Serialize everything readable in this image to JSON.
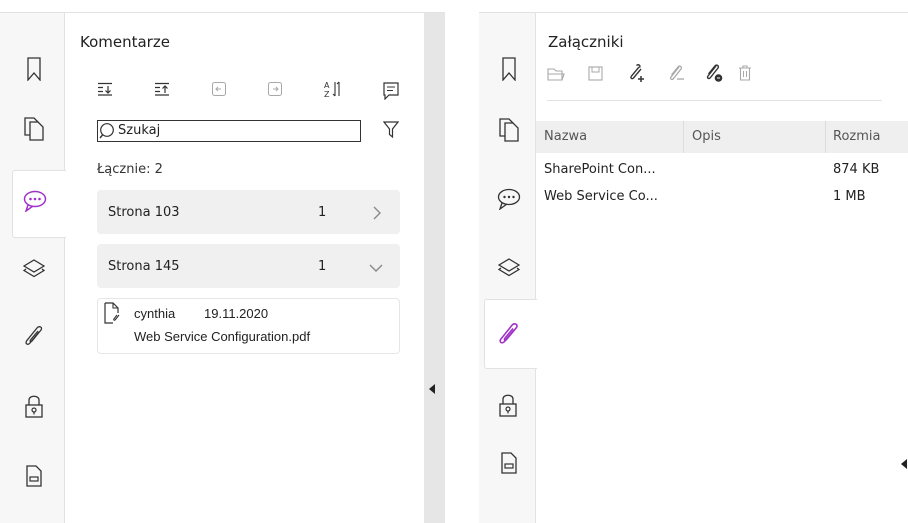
{
  "left": {
    "panel_title": "Komentarze",
    "search_placeholder": "Szukaj",
    "total_label": "Łącznie: 2",
    "groups": [
      {
        "label": "Strona 103",
        "count": "1",
        "expanded": false
      },
      {
        "label": "Strona 145",
        "count": "1",
        "expanded": true
      }
    ],
    "comment": {
      "author": "cynthia",
      "date": "19.11.2020",
      "file": "Web Service Configuration.pdf"
    }
  },
  "right": {
    "panel_title": "Załączniki",
    "columns": [
      "Nazwa",
      "Opis",
      "Rozmia"
    ],
    "rows": [
      {
        "name": "SharePoint Con...",
        "desc": "",
        "size": "874 KB"
      },
      {
        "name": "Web Service Co...",
        "desc": "",
        "size": "1 MB"
      }
    ]
  },
  "colors": {
    "accent_purple": "#a032c8",
    "icon_gray": "#333333",
    "disabled_gray": "#a8a8a8",
    "sidebar_bg": "#f7f7f7",
    "group_bg": "#f0f0f0",
    "splitter_bg": "#e6e6e6",
    "header_bg": "#efefef"
  },
  "icons": [
    "bookmark-icon",
    "pages-icon",
    "comments-icon",
    "layers-icon",
    "attachment-icon",
    "lock-icon",
    "form-icon"
  ]
}
